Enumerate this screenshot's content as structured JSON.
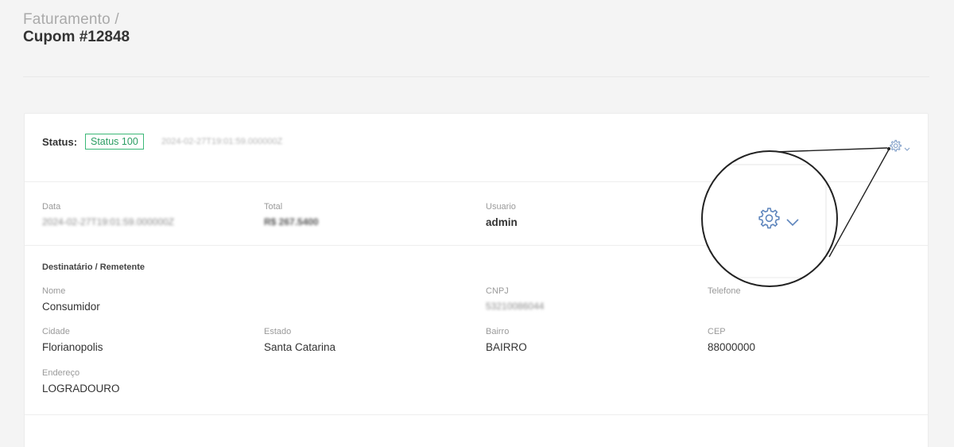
{
  "header": {
    "breadcrumb": "Faturamento /",
    "title": "Cupom #12848"
  },
  "status": {
    "label": "Status:",
    "badge": "Status 100",
    "badge_color": "#3cb878",
    "timestamp": "2024-02-27T19:01:59.000000Z",
    "actions_icon": "gear-icon"
  },
  "info": {
    "data": {
      "label": "Data",
      "value": "2024-02-27T19:01:59.000000Z"
    },
    "total": {
      "label": "Total",
      "value": "R$ 267.5400"
    },
    "usuario": {
      "label": "Usuario",
      "value": "admin"
    }
  },
  "recipient": {
    "section_title": "Destinatário / Remetente",
    "nome": {
      "label": "Nome",
      "value": "Consumidor"
    },
    "cnpj": {
      "label": "CNPJ",
      "value": "53210086044"
    },
    "telefone": {
      "label": "Telefone",
      "value": ""
    },
    "cidade": {
      "label": "Cidade",
      "value": "Florianopolis"
    },
    "estado": {
      "label": "Estado",
      "value": "Santa Catarina"
    },
    "bairro": {
      "label": "Bairro",
      "value": "BAIRRO"
    },
    "cep": {
      "label": "CEP",
      "value": "88000000"
    },
    "endereco": {
      "label": "Endereço",
      "value": "LOGRADOURO"
    }
  }
}
